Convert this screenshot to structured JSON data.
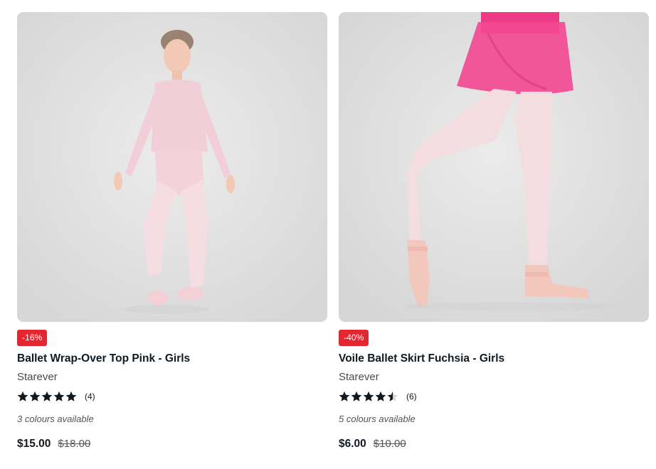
{
  "products": [
    {
      "image_alt": "Ballet Wrap-Over Top Pink - Girls",
      "discount": "-16%",
      "title": "Ballet Wrap-Over Top Pink - Girls",
      "brand": "Starever",
      "rating": 5,
      "reviews": "(4)",
      "colours": "3 colours available",
      "price": "$15.00",
      "old_price": "$18.00"
    },
    {
      "image_alt": "Voile Ballet Skirt Fuchsia - Girls",
      "discount": "-40%",
      "title": "Voile Ballet Skirt Fuchsia - Girls",
      "brand": "Starever",
      "rating": 4.5,
      "reviews": "(6)",
      "colours": "5 colours available",
      "price": "$6.00",
      "old_price": "$10.00"
    }
  ],
  "colors": {
    "badge_bg": "#e3262f",
    "text": "#101820",
    "star_filled": "#101820",
    "star_empty": "#d6d6d6"
  }
}
